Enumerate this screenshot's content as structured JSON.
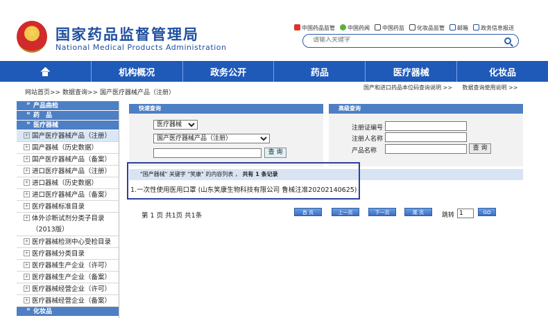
{
  "corner_text": "",
  "header": {
    "title_cn": "国家药品监督管理局",
    "title_en": "National Medical Products Administration",
    "links": [
      "中国药品监管",
      "中国药闻",
      "中国药监",
      "化妆品监管",
      "邮箱",
      "政务信息报送"
    ],
    "search_placeholder": "请输入关键字"
  },
  "nav": [
    "机构概况",
    "政务公开",
    "药品",
    "医疗器械",
    "化妆品"
  ],
  "breadcrumb": {
    "home": "网站首页",
    "sep": ">>",
    "level2": "数据查询",
    "level3": "国产医疗器械产品（注册）"
  },
  "top_right_links": [
    "国产和进口药品本位码查询说明 >>",
    "数据查询使用说明 >>"
  ],
  "sidebar": {
    "head_products": "产品曲检",
    "head_drugs": "药　品",
    "head_devices": "医疗器械",
    "items": [
      "国产医疗器械产品（注册）",
      "国产器械（历史数据）",
      "国产医疗器械产品（备案）",
      "进口医疗器械产品（注册）",
      "进口器械（历史数据）",
      "进口医疗器械产品（备案）",
      "医疗器械标准目录",
      "体外诊断试剂分类子目录（2013版）",
      "医疗器械检测中心受检目录",
      "医疗器械分类目录",
      "医疗器械生产企业（许可）",
      "医疗器械生产企业（备案）",
      "医疗器械经营企业（许可）",
      "医疗器械经营企业（备案）"
    ],
    "head_cosmetics": "化妆品"
  },
  "quick_search": {
    "title": "快速查询",
    "category": "医疗器械",
    "subcategory": "国产医疗器械产品（注册）",
    "keyword": "",
    "button": "查 询"
  },
  "advanced_search": {
    "title": "高级查询",
    "label_reg_no": "注册证编号",
    "label_registrant": "注册人名称",
    "label_product": "产品名称",
    "button": "查 询"
  },
  "results": {
    "summary_prefix": "\"国产器械\" 关键字 \"笑康\" 的内容列表 ，",
    "summary_count": "共有 1 条记录",
    "row": "1.一次性使用医用口罩 (山东笑康生物科技有限公司 鲁械注准20202140625)"
  },
  "pager": {
    "info": "第 1 页 共1页 共1条",
    "first": "首 页",
    "prev": "上一页",
    "next": "下一页",
    "last": "尾 页",
    "jump_label": "跳转",
    "jump_value": "1",
    "go": "GO"
  },
  "colors": {
    "nav_blue": "#1f5ab8",
    "panel_blue": "#4d7fc4",
    "title_blue": "#1f4fa0",
    "highlight": "#2b3f9e"
  }
}
